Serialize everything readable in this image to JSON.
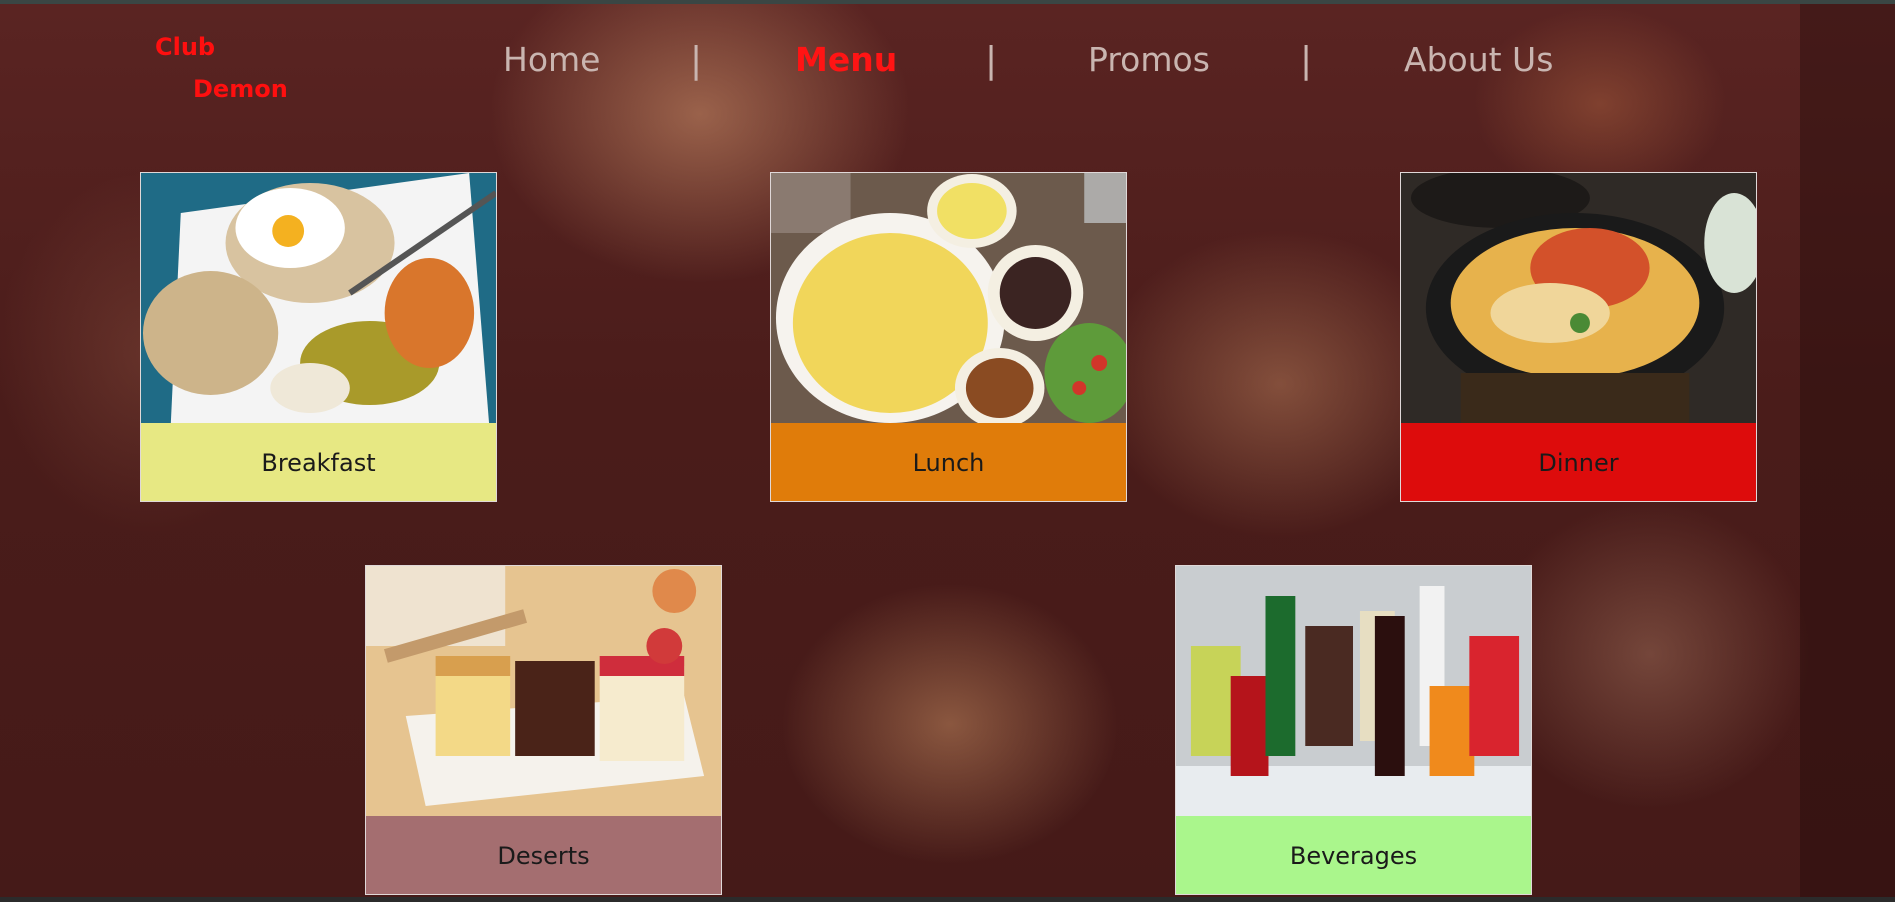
{
  "brand": {
    "line1": "Club",
    "line2": "Demon"
  },
  "nav": {
    "items": [
      {
        "label": "Home",
        "active": false
      },
      {
        "label": "Menu",
        "active": true
      },
      {
        "label": "Promos",
        "active": false
      },
      {
        "label": "About Us",
        "active": false
      }
    ],
    "separator": "|"
  },
  "menu": {
    "cards": [
      {
        "label": "Breakfast",
        "caption_color": "#e7e883"
      },
      {
        "label": "Lunch",
        "caption_color": "#e07c0a"
      },
      {
        "label": "Dinner",
        "caption_color": "#dd0c0c"
      },
      {
        "label": "Deserts",
        "caption_color": "#a46e70"
      },
      {
        "label": "Beverages",
        "caption_color": "#aaf68c"
      }
    ]
  },
  "colors": {
    "brand_red": "#ff0f0f",
    "nav_text": "#c9b5b0"
  }
}
